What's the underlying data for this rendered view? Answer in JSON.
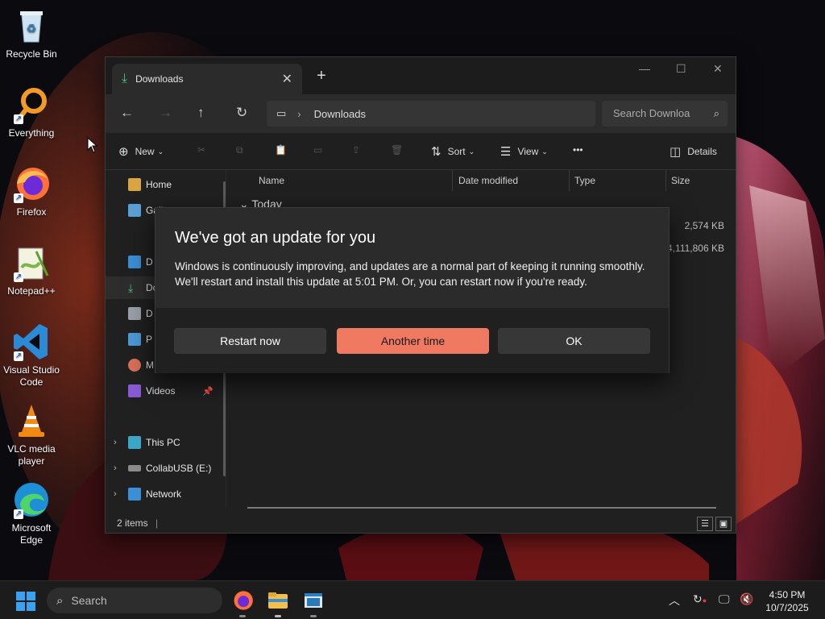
{
  "desktop": {
    "icons": [
      {
        "label": "Recycle Bin"
      },
      {
        "label": "Everything"
      },
      {
        "label": "Firefox"
      },
      {
        "label": "Notepad++"
      },
      {
        "label": "Visual Studio Code"
      },
      {
        "label": "VLC media player"
      },
      {
        "label": "Microsoft Edge"
      }
    ]
  },
  "explorer": {
    "tab_title": "Downloads",
    "new_tab": "+",
    "address_crumb": "Downloads",
    "search_placeholder": "Search Downloa",
    "toolbar": {
      "new_label": "New",
      "sort_label": "Sort",
      "view_label": "View",
      "more_label": "•••",
      "details_label": "Details"
    },
    "sidebar": {
      "home": "Home",
      "gallery": "Gall",
      "desktop": "D",
      "downloads": "Do",
      "documents": "D",
      "pictures": "P",
      "music": "M",
      "videos": "Videos",
      "this_pc": "This PC",
      "usb": "CollabUSB (E:)",
      "network": "Network"
    },
    "columns": [
      "Name",
      "Date modified",
      "Type",
      "Size"
    ],
    "group": "Today",
    "sizes": [
      "2,574 KB",
      "4,111,806 KB"
    ],
    "status": "2 items"
  },
  "dialog": {
    "title": "We've got an update for you",
    "message": "Windows is continuously improving, and updates are a normal part of keeping it running smoothly. We'll restart and install this update at 5:01 PM. Or, you can restart now if you're ready.",
    "restart_now": "Restart now",
    "another_time": "Another time",
    "ok": "OK",
    "accent_color": "#ef7a61"
  },
  "taskbar": {
    "search_placeholder": "Search",
    "time": "4:50 PM",
    "date": "10/7/2025"
  }
}
